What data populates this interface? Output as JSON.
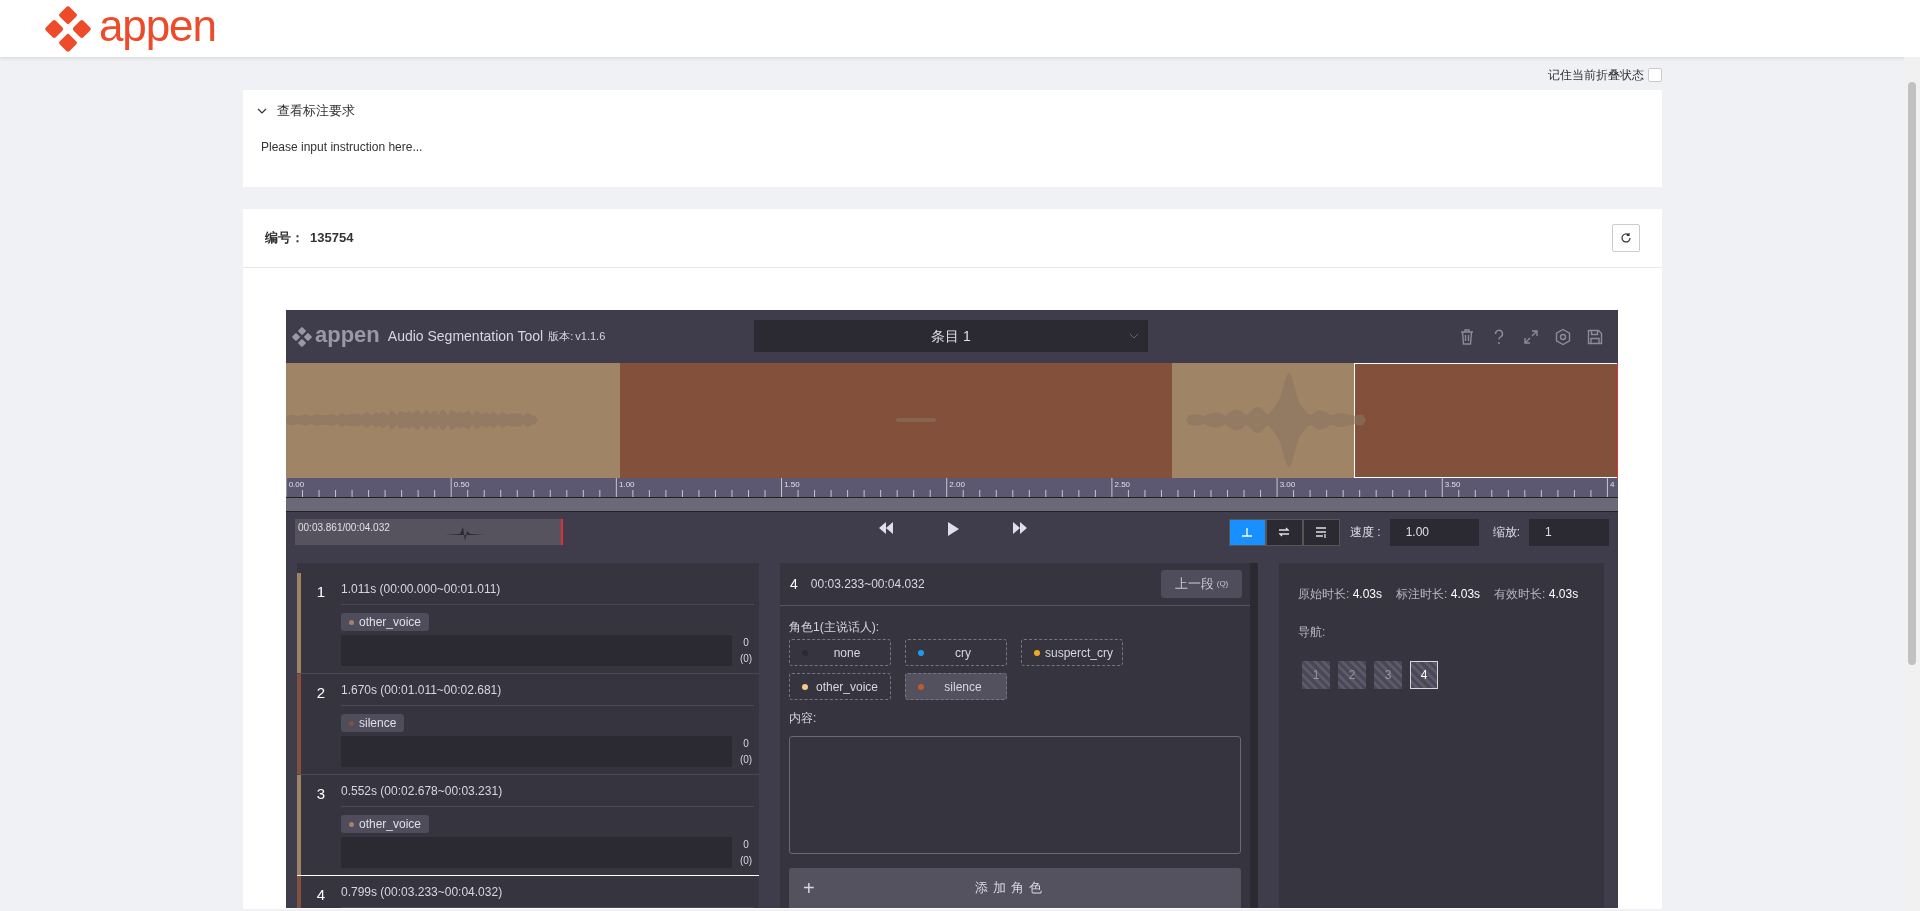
{
  "header": {
    "logo": "appen"
  },
  "remember_fold": {
    "label": "记住当前折叠状态",
    "checked": false
  },
  "instructions": {
    "title": "查看标注要求",
    "expanded": true,
    "text": "Please input instruction here..."
  },
  "task": {
    "label": "编号：",
    "id": "135754"
  },
  "tool": {
    "logo": "appen",
    "title": "Audio Segmentation Tool",
    "version_label": "版本:",
    "version": "v1.1.6",
    "item_select": "条目 1"
  },
  "waveform": {
    "regions": [
      {
        "color": "#a08466",
        "selected": false
      },
      {
        "color": "#83503b",
        "selected": false
      },
      {
        "color": "#a08466",
        "selected": false
      },
      {
        "color": "#83503b",
        "selected": true
      }
    ],
    "ticks": [
      "0.00",
      "0.50",
      "1.00",
      "1.50",
      "2.00",
      "2.50",
      "3.00",
      "3.50",
      "4"
    ]
  },
  "controls": {
    "position": "00:03.861/00:04.032",
    "modes": [
      {
        "selected": true
      },
      {
        "selected": false
      },
      {
        "selected": false
      }
    ],
    "speed_label": "速度 :",
    "speed": "1.00",
    "zoom_label": "缩放:",
    "zoom": "1"
  },
  "segments": [
    {
      "number": "1",
      "info": "1.011s (00:00.000~00:01.011)",
      "tag": "other_voice",
      "color": "#a08466",
      "count": "0",
      "count_total": "(0)",
      "selected": false
    },
    {
      "number": "2",
      "info": "1.670s (00:01.011~00:02.681)",
      "tag": "silence",
      "color": "#83503b",
      "count": "0",
      "count_total": "(0)",
      "selected": false
    },
    {
      "number": "3",
      "info": "0.552s (00:02.678~00:03.231)",
      "tag": "other_voice",
      "color": "#a08466",
      "count": "0",
      "count_total": "(0)",
      "selected": false
    },
    {
      "number": "4",
      "info": "0.799s (00:03.233~00:04.032)",
      "color": "#83503b",
      "selected": true
    }
  ],
  "editor": {
    "number": "4",
    "range": "00:03.233~00:04.032",
    "prev_button": "上一段",
    "prev_key": "(Q)",
    "role_label": "角色1(主说话人):",
    "options": [
      {
        "label": "none",
        "color": "#2b2a33",
        "selected": false
      },
      {
        "label": "cry",
        "color": "#1e9bf0",
        "selected": false
      },
      {
        "label": "susperct_cry",
        "color": "#f5a623",
        "selected": false
      },
      {
        "label": "other_voice",
        "color": "#f3c98b",
        "selected": false
      },
      {
        "label": "silence",
        "color": "#c0592d",
        "selected": true
      }
    ],
    "content_label": "内容:",
    "add_icon": "+",
    "add_button": "添加角色"
  },
  "summary": {
    "stats": [
      {
        "label": "原始时长:",
        "value": "4.03s"
      },
      {
        "label": "标注时长:",
        "value": "4.03s"
      },
      {
        "label": "有效时长:",
        "value": "4.03s"
      }
    ],
    "nav_label": "导航:",
    "nav": [
      {
        "label": "1",
        "selected": false
      },
      {
        "label": "2",
        "selected": false
      },
      {
        "label": "3",
        "selected": false
      },
      {
        "label": "4",
        "selected": true
      }
    ]
  }
}
